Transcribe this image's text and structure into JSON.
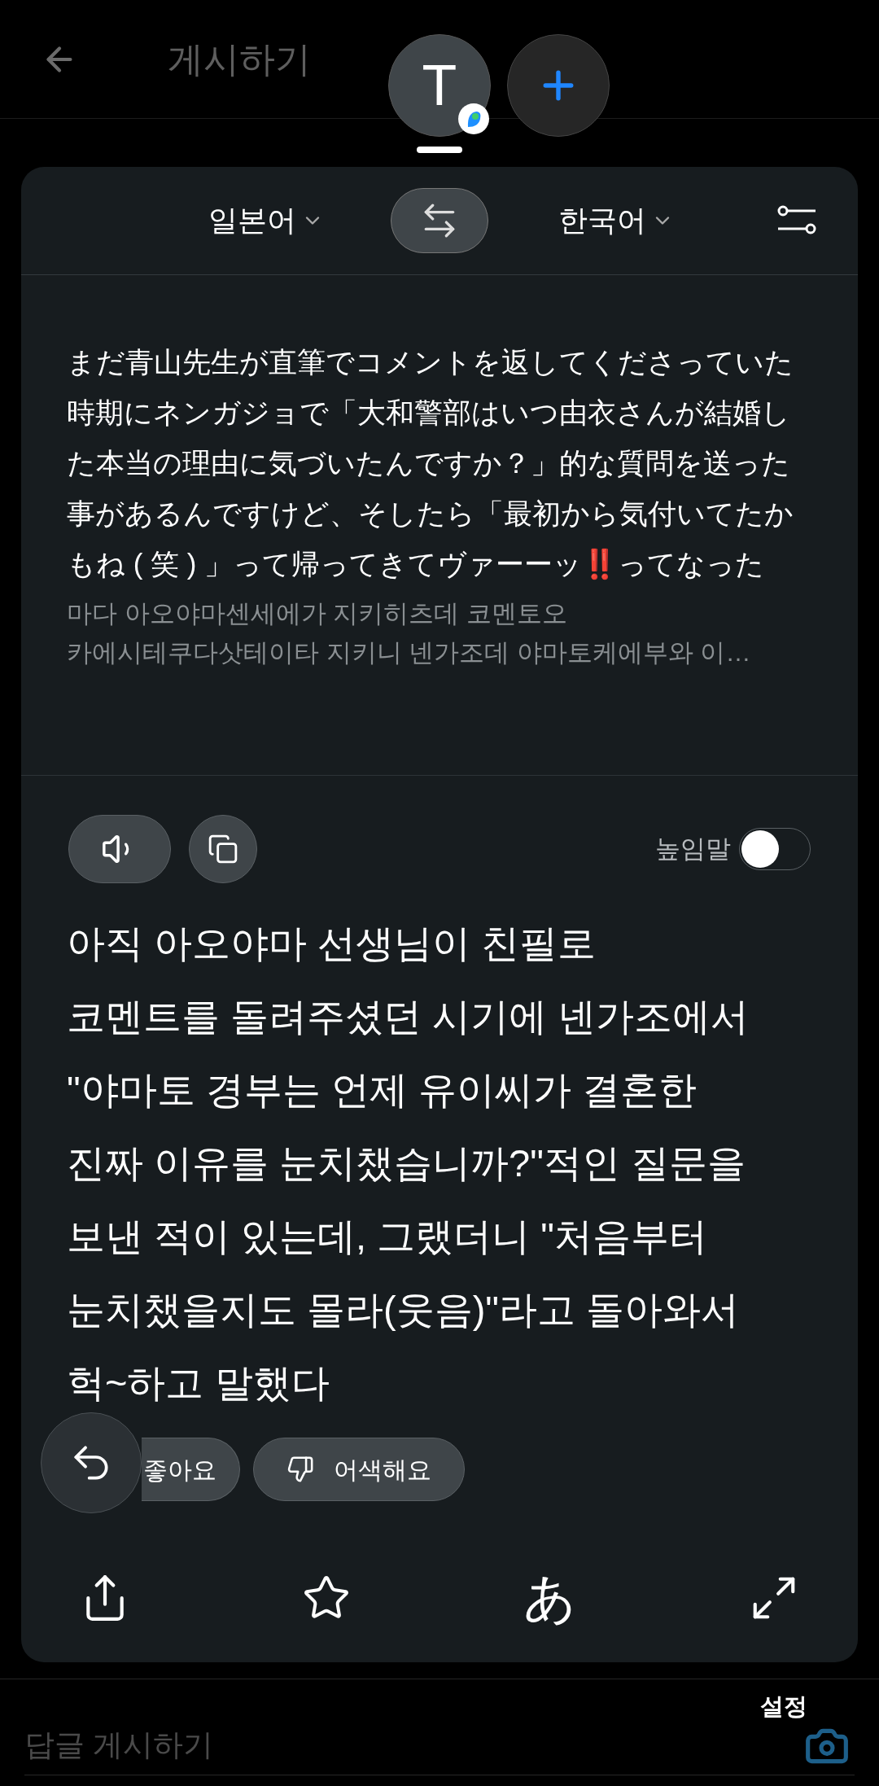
{
  "header": {
    "title": "게시하기"
  },
  "floating": {
    "translate_letter": "T"
  },
  "translator": {
    "source_language": "일본어",
    "target_language": "한국어",
    "original_text": "まだ青山先生が直筆でコメントを返してくださっていた時期にネンガジョで「大和警部はいつ由衣さんが結婚した本当の理由に気づいたんですか？」的な質問を送った事があるんですけど、そしたら「最初から気付いてたかもね ( 笑 ) 」って帰ってきてヴァーーッ‼️ってなった",
    "pronunciation": "마다 아오야마센세에가 지키히츠데 코멘토오\n카에시테쿠다삿테이타 지키니 넨가조데 야마토케에부와 이…",
    "honorific": {
      "label": "높임말",
      "on": false
    },
    "translated_text": "아직 아오야마 선생님이 친필로\n코멘트를 돌려주셨던 시기에 넨가조에서\n\"야마토 경부는 언제 유이씨가 결혼한\n진짜 이유를 눈치챘습니까?\"적인 질문을\n보낸 적이 있는데, 그랬더니 \"처음부터\n눈치챘을지도 몰라(웃음)\"라고 돌아와서\n헉~하고 말했다",
    "feedback": [
      {
        "kind": "like",
        "label": "좋아요"
      },
      {
        "kind": "dislike",
        "label": "어색해요"
      }
    ],
    "kana_button": "あ"
  },
  "reply_bar": {
    "settings_label": "설정",
    "placeholder": "답글 게시하기"
  }
}
